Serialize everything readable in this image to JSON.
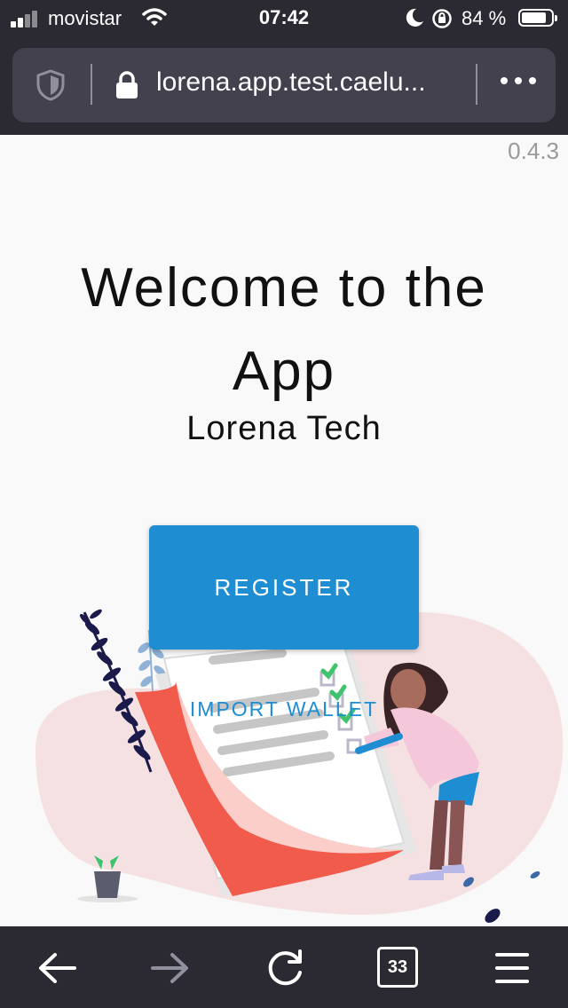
{
  "status_bar": {
    "carrier": "movistar",
    "time": "07:42",
    "battery_percent": "84 %",
    "battery_level": 0.84,
    "icons": [
      "signal-icon",
      "wifi-icon",
      "moon-icon",
      "rotation-lock-icon",
      "battery-icon"
    ]
  },
  "browser": {
    "url": "lorena.app.test.caelu...",
    "icons": [
      "tracking-shield-icon",
      "lock-icon",
      "more-icon"
    ],
    "toolbar": {
      "tabs_count": "33",
      "icons": [
        "back-icon",
        "forward-icon",
        "reload-icon",
        "tabs-icon",
        "menu-icon"
      ]
    }
  },
  "page": {
    "version": "0.4.3",
    "title": "Welcome to the App",
    "subtitle": "Lorena Tech",
    "register_label": "REGISTER",
    "import_label": "IMPORT WALLET"
  },
  "colors": {
    "chrome": "#2b2a33",
    "url_bar": "#42414d",
    "accent": "#1f8dd2",
    "background": "#f9f9f9"
  }
}
